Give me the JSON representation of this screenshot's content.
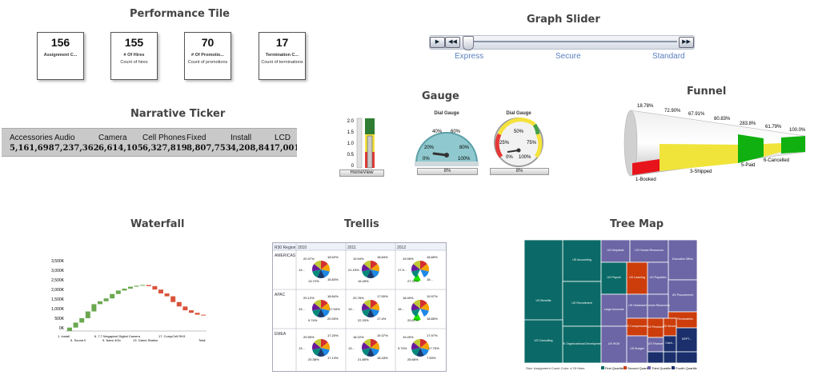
{
  "sections": {
    "performance_tile": "Performance Tile",
    "graph_slider": "Graph Slider",
    "narrative_ticker": "Narrative Ticker",
    "gauge": "Gauge",
    "funnel": "Funnel",
    "waterfall": "Waterfall",
    "trellis": "Trellis",
    "tree_map": "Tree Map"
  },
  "tiles": [
    {
      "value": "156",
      "label": "Assignment C...",
      "sub": ""
    },
    {
      "value": "155",
      "label": "# Of Hires",
      "sub": "Count of hires"
    },
    {
      "value": "70",
      "label": "# Of Promotio...",
      "sub": "Count of promotions"
    },
    {
      "value": "17",
      "label": "Termination C...",
      "sub": "Count of terminations"
    }
  ],
  "ticker": [
    {
      "label": "Accessories",
      "value": "5,161,698"
    },
    {
      "label": "Audio",
      "value": "7,237,362"
    },
    {
      "label": "Camera",
      "value": "6,614,105"
    },
    {
      "label": "Cell Phones",
      "value": "6,327,819"
    },
    {
      "label": "Fixed",
      "value": "8,807,753"
    },
    {
      "label": "Install",
      "value": "4,208,841"
    },
    {
      "label": "LCD",
      "value": "7,001"
    }
  ],
  "slider": {
    "buttons": {
      "play": "▶",
      "rewind": "◀◀",
      "forward": "▶▶"
    },
    "labels": [
      "Express",
      "Secure",
      "Standard"
    ],
    "position": 0
  },
  "gauges": {
    "bulb": {
      "ticks": [
        "2.0",
        "1.5",
        "1.0",
        "0.5",
        "0"
      ],
      "caption": "HomeView"
    },
    "dial1": {
      "title": "Dial Gauge",
      "ticks": [
        "20%",
        "40%",
        "60%",
        "80%",
        "0%",
        "100%"
      ],
      "value_label": "8%",
      "value": 8
    },
    "dial2": {
      "title": "Dial Gauge",
      "ticks": [
        "25%",
        "50%",
        "75%",
        "0%",
        "100%"
      ],
      "value_label": "8%",
      "value": 8
    }
  },
  "funnel": {
    "percent_labels": [
      "18.78%",
      "72.90%",
      "67.91%",
      "80.83%",
      "283.8%",
      "61.79%",
      "100.0%"
    ],
    "stage_labels": [
      "1-Booked",
      "3-Shipped",
      "5-Paid",
      "6-Cancelled"
    ],
    "colors": {
      "red": "#e8141c",
      "yellow": "#f0e43a",
      "green": "#10b010",
      "gray": "#cfcfcf"
    }
  },
  "waterfall": {
    "y_ticks": [
      "3,500K",
      "3,000K",
      "2,500K",
      "2,000K",
      "1,500K",
      "1,000K",
      "500K",
      "0K"
    ],
    "x_labels": [
      "1. Install",
      "5. Sound Ii",
      "6. 7.7 Megapixel Digital Camera",
      "9. Nano 4Gb",
      "13. Game Station",
      "17. CompCell RH3",
      "Total"
    ],
    "values": [
      180,
      260,
      230,
      350,
      380,
      150,
      150,
      230,
      180,
      100,
      100,
      50,
      40,
      -60,
      -180,
      -200,
      -150,
      -300,
      -230,
      -200,
      -130,
      -100,
      -30
    ],
    "total": 120,
    "colors": {
      "up": "#6aa84f",
      "down": "#d9533b",
      "total": "#3c8ab8"
    }
  },
  "trellis": {
    "header": [
      "R30 Region",
      "2010",
      "2011",
      "2012"
    ],
    "rows": [
      {
        "name": "AMERICAS",
        "labels": [
          [
            "20.37%",
            "18.52%",
            "13...",
            "13.72%",
            "15.83%"
          ],
          [
            "19.94%",
            "18.84%",
            "21.15%",
            "15.45%"
          ],
          [
            "19.95%",
            "18.85%",
            "17.9...",
            "27.22%",
            "15..."
          ]
        ]
      },
      {
        "name": "APAC",
        "labels": [
          [
            "20.12%",
            "18.84%",
            "13...",
            "9.74%",
            "20.93%",
            "17.54%"
          ],
          [
            "20.76%",
            "17.50%",
            "13...",
            "22.33%",
            "17.4%"
          ],
          [
            "18.49%",
            "19.97%",
            "15...",
            "20.67%",
            "18.85%"
          ]
        ]
      },
      {
        "name": "EMEA",
        "labels": [
          [
            "20.55%",
            "17.20%",
            "13...",
            "20.38%",
            "17.13%"
          ],
          [
            "18.22%",
            "19.37%",
            "13...",
            "21.85%",
            "18.18%"
          ],
          [
            "19.49%",
            "17.97%",
            "9.70%",
            "25.66%",
            "7.53%",
            "17.75%"
          ]
        ]
      }
    ]
  },
  "treemap": {
    "cells": [
      {
        "label": "US Accounting"
      },
      {
        "label": "US Helpdesk"
      },
      {
        "label": "US Human Resources"
      },
      {
        "label": "Executive Office"
      },
      {
        "label": "US Benefits"
      },
      {
        "label": "US Recruitment"
      },
      {
        "label": "US Payroll"
      },
      {
        "label": "US Learning"
      },
      {
        "label": "US Payables"
      },
      {
        "label": "US Procurement"
      },
      {
        "label": "US Organizational Development"
      },
      {
        "label": "Large Accounts"
      },
      {
        "label": "US Hardware"
      },
      {
        "label": "Human Resources"
      },
      {
        "label": "US Receivables"
      },
      {
        "label": "US Compensation"
      },
      {
        "label": "US Pensions"
      },
      {
        "label": "US Service"
      },
      {
        "label": "US Consulting"
      },
      {
        "label": "US HCM"
      },
      {
        "label": "US Budget"
      },
      {
        "label": "US Finance"
      },
      {
        "label": "Cash..."
      },
      {
        "label": "DEPT..."
      }
    ],
    "legend_left": [
      "Size:",
      "Assignment Count",
      "Color:",
      "# Of Hires"
    ],
    "legend_right": [
      "First Quartile",
      "Second Quartile",
      "Third Quartile",
      "Fourth Quartile"
    ],
    "colors": {
      "teal": "#0b6a67",
      "purple": "#6c66a6",
      "orange": "#cc3d0b",
      "navy": "#1a2f6b"
    }
  }
}
